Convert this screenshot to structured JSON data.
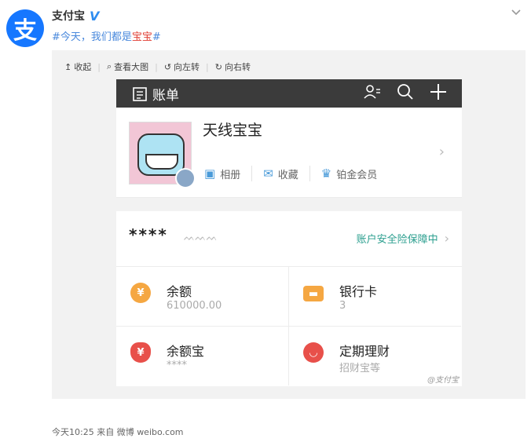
{
  "post": {
    "author": "支付宝",
    "verified_mark": "V",
    "avatar_char": "支",
    "topic_prefix": "#今天，我们都是",
    "topic_highlight": "宝宝",
    "topic_suffix": "#",
    "footer": "今天10:25 来自 微博 weibo.com"
  },
  "toolbar": {
    "items": [
      {
        "icon": "↥",
        "label": "收起"
      },
      {
        "icon": "⌕",
        "label": "查看大图"
      },
      {
        "icon": "↺",
        "label": "向左转"
      },
      {
        "icon": "↻",
        "label": "向右转"
      }
    ]
  },
  "phone": {
    "topbar": {
      "title": "账单"
    },
    "profile": {
      "name": "天线宝宝",
      "links": [
        {
          "label": "相册",
          "icon": "▣"
        },
        {
          "label": "收藏",
          "icon": "✉"
        },
        {
          "label": "铂金会员",
          "icon": "♛"
        }
      ]
    },
    "security": {
      "masked": "****",
      "eye": "ᨓᨓᨓ",
      "text": "账户安全险保障中",
      "arrow": "›"
    },
    "cells": [
      {
        "title": "余额",
        "sub": "610000.00",
        "icon": "¥",
        "color": "#f5a742"
      },
      {
        "title": "银行卡",
        "sub": "3",
        "icon": "▬",
        "color": "#f5a742"
      },
      {
        "title": "余额宝",
        "sub": "****",
        "icon": "¥",
        "color": "#e8504a"
      },
      {
        "title": "定期理财",
        "sub": "招财宝等",
        "icon": "◡",
        "color": "#e8504a"
      }
    ],
    "watermark": "@支付宝"
  }
}
